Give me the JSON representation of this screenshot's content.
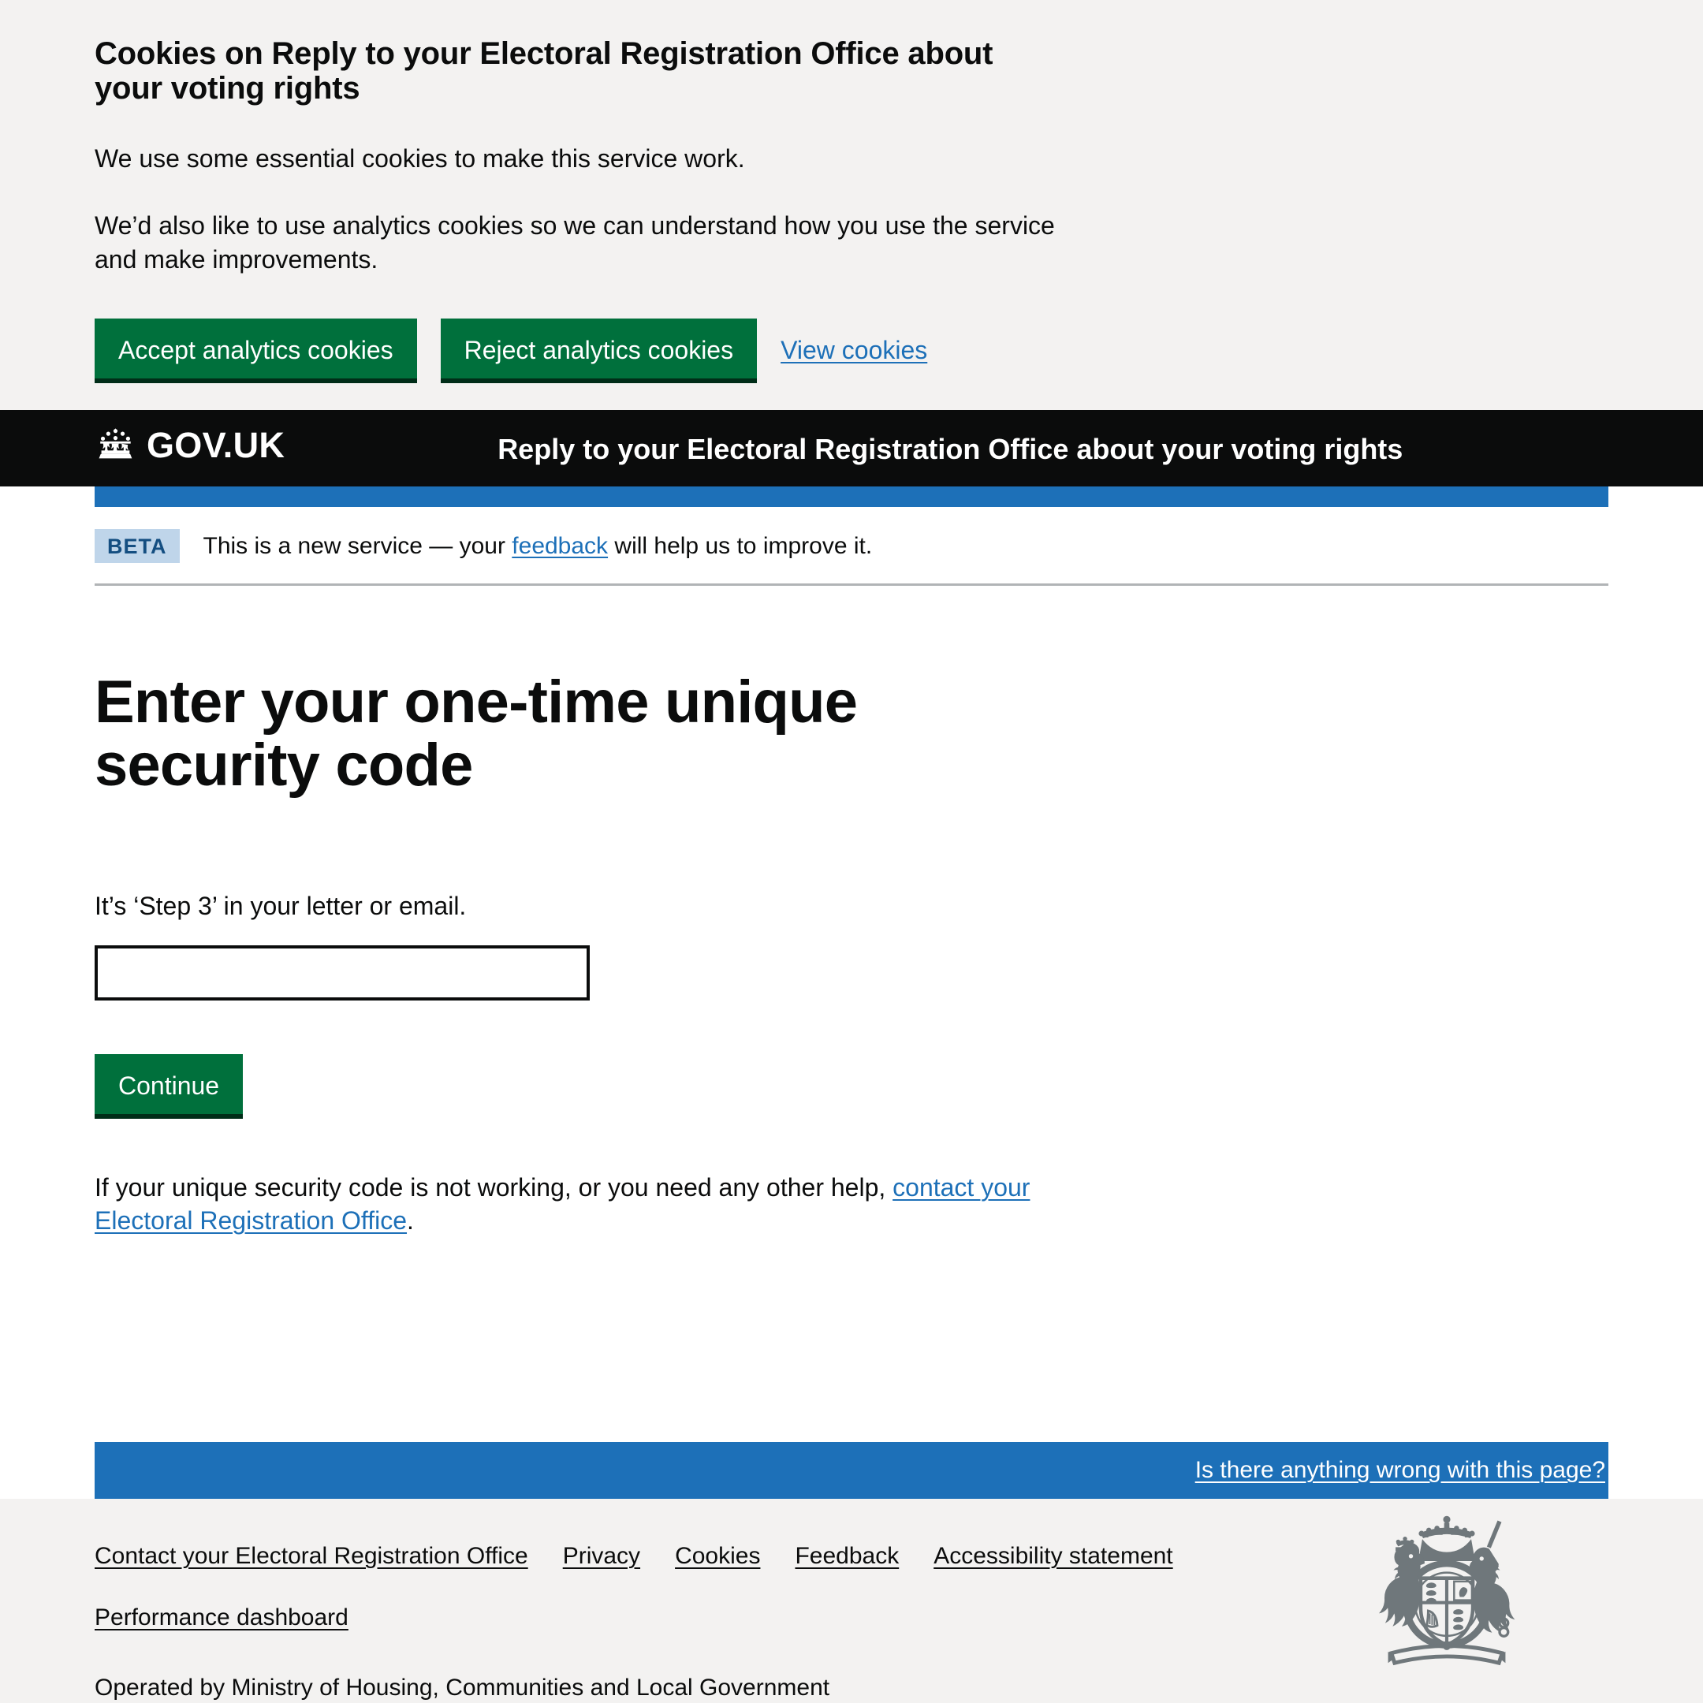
{
  "cookie_banner": {
    "title": "Cookies on Reply to your Electoral Registration Office about your voting rights",
    "paragraph_1": "We use some essential cookies to make this service work.",
    "paragraph_2": "We’d also like to use analytics cookies so we can understand how you use the service and make improvements.",
    "accept_label": "Accept analytics cookies",
    "reject_label": "Reject analytics cookies",
    "view_cookies_label": "View cookies"
  },
  "header": {
    "logo_text": "GOV.UK",
    "logo_icon": "crown-icon",
    "service_name": "Reply to your Electoral Registration Office about your voting rights"
  },
  "phase_banner": {
    "tag": "BETA",
    "text_before": "This is a new service — your ",
    "link": "feedback",
    "text_after": " will help us to improve it."
  },
  "main": {
    "heading": "Enter your one-time unique security code",
    "hint": "It’s ‘Step 3’ in your letter or email.",
    "input_value": "",
    "input_placeholder": "",
    "continue_label": "Continue",
    "help_text_before": "If your unique security code is not working, or you need any other help, ",
    "help_link": "contact your Electoral Registration Office",
    "help_text_after": "."
  },
  "feedback_banner": {
    "link": "Is there anything wrong with this page?"
  },
  "footer": {
    "links": [
      "Contact your Electoral Registration Office",
      "Privacy",
      "Cookies",
      "Feedback",
      "Accessibility statement",
      "Performance dashboard"
    ],
    "operated_by": "Operated by Ministry of Housing, Communities and Local Government",
    "crest_icon": "royal-coat-of-arms-icon"
  },
  "colors": {
    "green": "#00703c",
    "blue": "#1d70b8",
    "black": "#0b0c0c",
    "grey": "#f3f2f1",
    "beta_tag_bg": "#bfd5ea",
    "beta_tag_text": "#144e81",
    "border_grey": "#b1b4b6"
  }
}
